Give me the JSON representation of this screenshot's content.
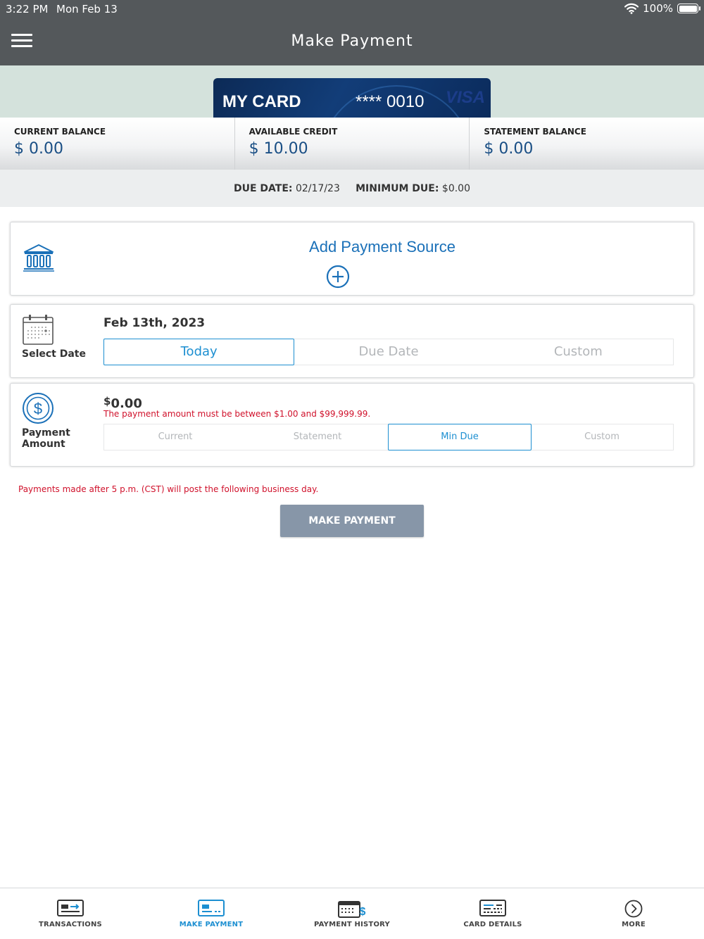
{
  "status_bar": {
    "time": "3:22 PM",
    "date": "Mon Feb 13",
    "battery": "100%"
  },
  "header": {
    "title": "Make Payment"
  },
  "card": {
    "name": "MY CARD",
    "number": "**** 0010",
    "brand": "VISA"
  },
  "balances": [
    {
      "label": "CURRENT BALANCE",
      "value": "$ 0.00"
    },
    {
      "label": "AVAILABLE CREDIT",
      "value": "$ 10.00"
    },
    {
      "label": "STATEMENT BALANCE",
      "value": "$ 0.00"
    }
  ],
  "due": {
    "due_date_label": "DUE DATE:",
    "due_date": "02/17/23",
    "min_due_label": "MINIMUM DUE:",
    "min_due": "$0.00"
  },
  "payment_source": {
    "label": "Add Payment Source"
  },
  "select_date": {
    "label": "Select Date",
    "value": "Feb 13th, 2023",
    "options": [
      "Today",
      "Due Date",
      "Custom"
    ],
    "selected": "Today"
  },
  "payment_amount": {
    "label_line1": "Payment",
    "label_line2": "Amount",
    "currency_symbol": "$",
    "value": "0.00",
    "error": "The payment amount must be between $1.00 and $99,999.99.",
    "options": [
      "Current",
      "Statement",
      "Min Due",
      "Custom"
    ],
    "selected": "Min Due"
  },
  "notice": "Payments made after 5 p.m. (CST) will post the following business day.",
  "make_payment_button": "MAKE PAYMENT",
  "tabs": [
    {
      "label": "TRANSACTIONS",
      "icon": "transactions-icon"
    },
    {
      "label": "MAKE PAYMENT",
      "icon": "make-payment-icon",
      "active": true
    },
    {
      "label": "PAYMENT HISTORY",
      "icon": "payment-history-icon"
    },
    {
      "label": "CARD DETAILS",
      "icon": "card-details-icon"
    },
    {
      "label": "MORE",
      "icon": "more-icon"
    }
  ],
  "colors": {
    "header": "#54585b",
    "accent": "#1d8fd1",
    "link": "#1a70b8",
    "error": "#d0112b",
    "button": "#8796a8"
  }
}
